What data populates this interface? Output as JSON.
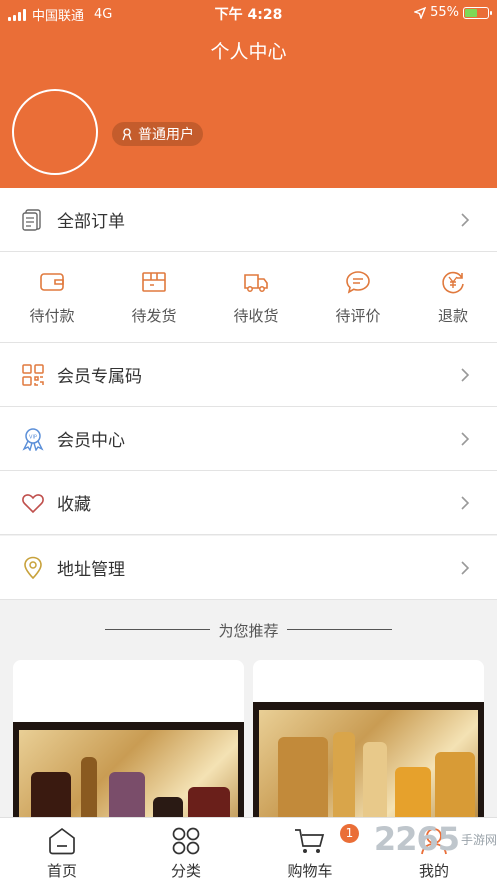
{
  "status_bar": {
    "carrier": "中国联通",
    "network": "4G",
    "time": "下午 4:28",
    "battery": "55%",
    "battery_level": 0.55
  },
  "header": {
    "title": "个人中心",
    "user_type": "普通用户"
  },
  "menu": {
    "all_orders": "全部订单",
    "member_code": "会员专属码",
    "member_center": "会员中心",
    "favorites": "收藏",
    "address": "地址管理"
  },
  "order_status": [
    {
      "label": "待付款",
      "icon": "wallet-icon"
    },
    {
      "label": "待发货",
      "icon": "package-icon"
    },
    {
      "label": "待收货",
      "icon": "truck-icon"
    },
    {
      "label": "待评价",
      "icon": "comment-icon"
    },
    {
      "label": "退款",
      "icon": "refund-icon"
    }
  ],
  "recommend": {
    "title": "为您推荐"
  },
  "tabbar": {
    "tabs": [
      {
        "label": "首页",
        "icon": "home-icon"
      },
      {
        "label": "分类",
        "icon": "category-icon"
      },
      {
        "label": "购物车",
        "icon": "cart-icon"
      },
      {
        "label": "我的",
        "icon": "user-icon"
      }
    ],
    "cart_badge": "1"
  },
  "watermark": {
    "number": "2265",
    "text": "手游网"
  },
  "colors": {
    "brand": "#ea6e37",
    "text": "#333333"
  }
}
